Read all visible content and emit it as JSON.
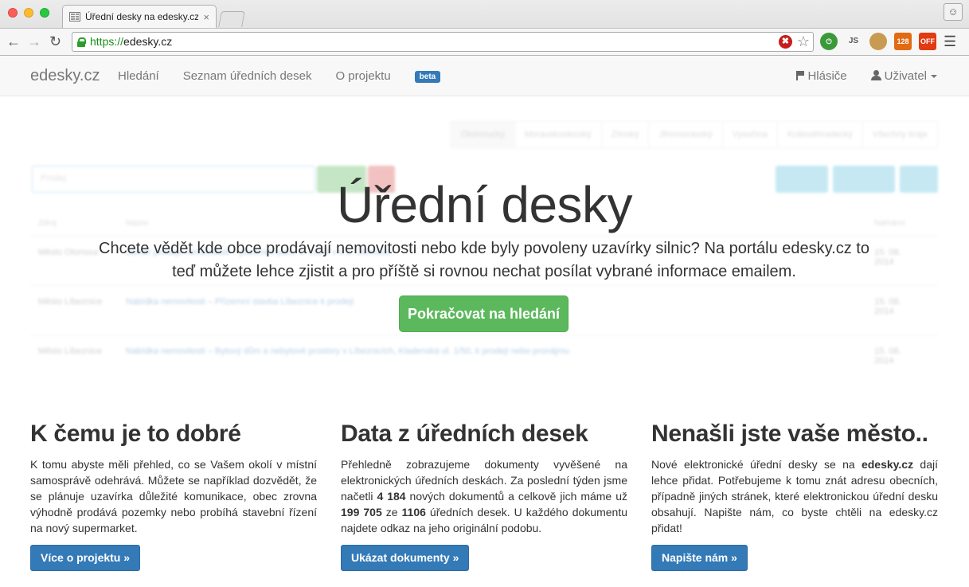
{
  "browser": {
    "tab_title": "Úřední desky na edesky.cz",
    "tab_close": "×",
    "url_scheme": "https://",
    "url_host": "edesky.cz",
    "ext_rss_count": "128",
    "ext_off": "OFF",
    "ext_js": "JS"
  },
  "navbar": {
    "brand": "edesky.cz",
    "links": [
      "Hledání",
      "Seznam úředních desek",
      "O projektu"
    ],
    "beta": "beta",
    "hlasice": "Hlásiče",
    "user": "Uživatel"
  },
  "preview": {
    "tabs": [
      "Olomoucký",
      "Moravskoslezský",
      "Zlínský",
      "Jihomoravský",
      "Vysočina",
      "Královéhradecký",
      "Všechny kraje"
    ],
    "search_placeholder": "Prodej",
    "columns": [
      "Zdroj",
      "Název",
      "Nahráno"
    ],
    "rows": [
      {
        "source": "Město Olomouc",
        "title": "Záměr prodeje nemovitosti – pozemek parc. č. 112/4 v k.ú. Olomouc",
        "date": "15. 08. 2014"
      },
      {
        "source": "Město Líbeznice",
        "title": "Nabídka nemovitosti – Přízemní stavba Líbeznice k prodeji",
        "date": "15. 08. 2014"
      },
      {
        "source": "Město Líbeznice",
        "title": "Nabídka nemovitosti – Bytový dům a nebytové prostory v Líbeznicích, Kladenská ul. 1/50, k prodeji nebo pronájmu",
        "date": "15. 08. 2014"
      }
    ]
  },
  "hero": {
    "title": "Úřední desky",
    "text": "Chcete vědět kde obce prodávají nemovitosti nebo kde byly povoleny uzavírky silnic? Na portálu edesky.cz to teď můžete lehce zjistit a pro příště si rovnou nechat posílat vybrané informace emailem.",
    "button": "Pokračovat na hledání"
  },
  "columns": [
    {
      "heading": "K čemu je to dobré",
      "text": "K tomu abyste měli přehled, co se Vašem okolí v místní samosprávě odehrává. Můžete se například dozvědět, že se plánuje uzavírka důležité komunikace, obec zrovna výhodně prodává pozemky nebo probíhá stavební řízení na nový supermarket.",
      "button": "Více o projektu »"
    },
    {
      "heading": "Data z úředních desek",
      "text_a": "Přehledně zobrazujeme dokumenty vyvěšené na elektronických úředních deskách. Za poslední týden jsme načetli ",
      "num_week": "4 184",
      "text_b": " nových dokumentů a celkově jich máme už ",
      "num_total": "199 705",
      "text_c": " ze ",
      "num_boards": "1106",
      "text_d": " úředních desek. U každého dokumentu najdete odkaz na jeho originální podobu.",
      "button": "Ukázat dokumenty »"
    },
    {
      "heading": "Nenašli jste vaše město..",
      "text_a": "Nové elektronické úřední desky se na ",
      "site": "edesky.cz",
      "text_b": " dají lehce přidat. Potřebujeme k tomu znát adresu obecních, případně jiných stránek, které elektronickou úřední desku obsahují. Napište nám, co byste chtěli na edesky.cz přidat!",
      "button": "Napište nám »"
    }
  ],
  "colors": {
    "success": "#5cb85c",
    "primary": "#337ab7",
    "url_secure": "#1a8e1a"
  }
}
